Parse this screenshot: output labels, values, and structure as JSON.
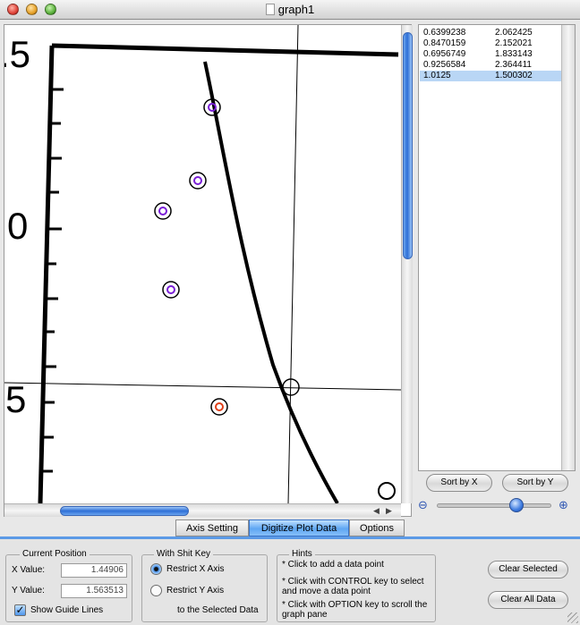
{
  "window": {
    "title": "graph1"
  },
  "plot": {
    "axis_labels": [
      ".5",
      "0",
      "5"
    ],
    "guide_line_color": "#000000",
    "marker_color_normal": "#7a1fd6",
    "marker_color_selected": "#e0401a"
  },
  "data_table": {
    "rows": [
      {
        "x": "0.6399238",
        "y": "2.062425",
        "selected": false
      },
      {
        "x": "0.8470159",
        "y": "2.152021",
        "selected": false
      },
      {
        "x": "0.6956749",
        "y": "1.833143",
        "selected": false
      },
      {
        "x": "0.9256584",
        "y": "2.364411",
        "selected": false
      },
      {
        "x": "1.0125",
        "y": "1.500302",
        "selected": true
      }
    ],
    "sort_x_label": "Sort by X",
    "sort_y_label": "Sort by Y",
    "zoom_out_icon": "magnifier-minus-icon",
    "zoom_in_icon": "magnifier-plus-icon",
    "zoom_level": 0.72
  },
  "tabs": [
    {
      "label": "Axis Setting",
      "active": false
    },
    {
      "label": "Digitize Plot Data",
      "active": true
    },
    {
      "label": "Options",
      "active": false
    }
  ],
  "current_position": {
    "title": "Current Position",
    "x_label": "X Value:",
    "x_value": "1.44906",
    "y_label": "Y Value:",
    "y_value": "1.563513",
    "guide_lines_label": "Show Guide Lines",
    "guide_lines_checked": true
  },
  "shift_key": {
    "title": "With Shit Key",
    "option_x": "Restrict X Axis",
    "option_y": "Restrict Y Axis",
    "suffix": "to the Selected Data",
    "selected": "x"
  },
  "hints": {
    "title": "Hints",
    "lines": [
      "* Click to add a data point",
      "* Click with CONTROL key to select",
      "and move a data point",
      "* Click with OPTION key to scroll the",
      "graph pane"
    ]
  },
  "buttons": {
    "clear_selected": "Clear Selected",
    "clear_all": "Clear All Data"
  }
}
